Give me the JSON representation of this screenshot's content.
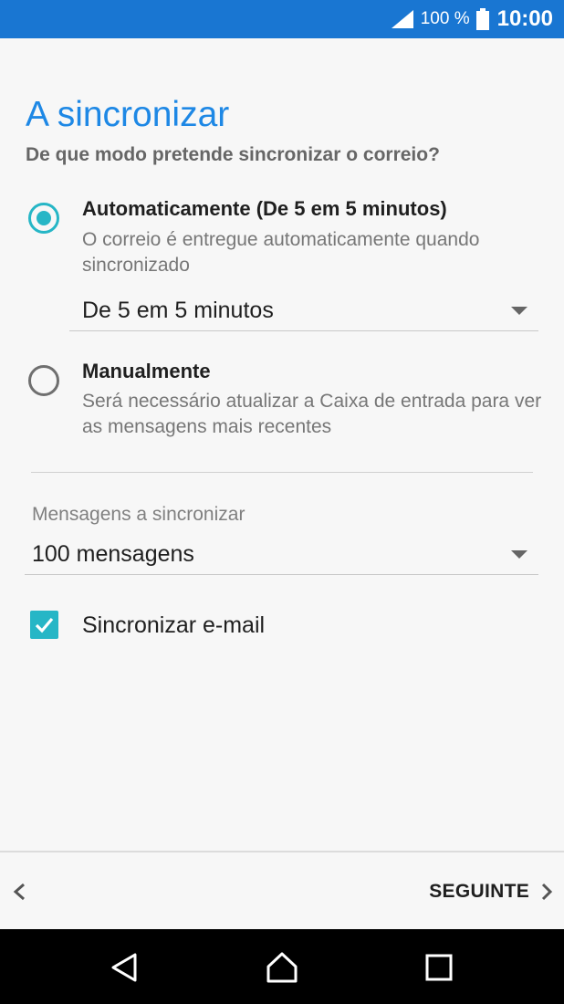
{
  "status_bar": {
    "battery_percent": "100 %",
    "time": "10:00",
    "icons": [
      "signal-icon",
      "battery-icon"
    ]
  },
  "page": {
    "title": "A sincronizar",
    "subtitle": "De que modo pretende sincronizar o correio?"
  },
  "sync_options": {
    "automatic": {
      "title": "Automaticamente (De 5 em 5 minutos)",
      "description": "O correio é entregue automaticamente quando sincronizado",
      "selected": true,
      "interval_value": "De 5 em 5 minutos"
    },
    "manual": {
      "title": "Manualmente",
      "description": "Será necessário atualizar a Caixa de entrada para ver as mensagens mais recentes",
      "selected": false
    }
  },
  "messages_to_sync": {
    "label": "Mensagens a sincronizar",
    "value": "100 mensagens"
  },
  "sync_email": {
    "label": "Sincronizar e-mail",
    "checked": true
  },
  "action_bar": {
    "next_label": "SEGUINTE"
  },
  "colors": {
    "status_bar": "#1976d2",
    "title": "#1e88e5",
    "accent": "#26b6c6"
  }
}
